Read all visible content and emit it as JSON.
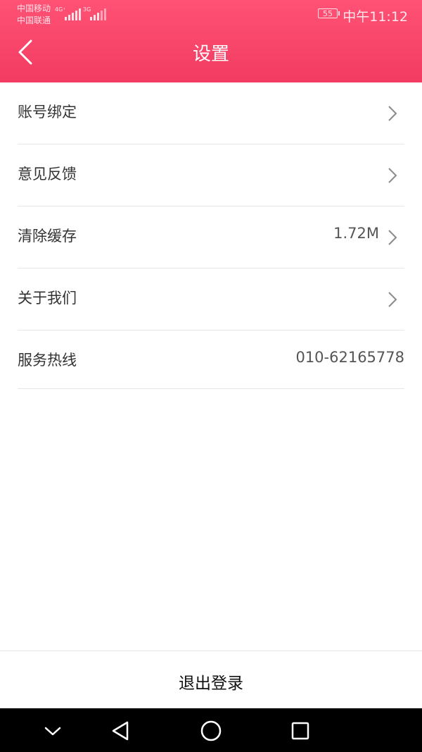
{
  "status_bar": {
    "carrier_1": "中国移动",
    "carrier_2": "中国联通",
    "network_1": "4G⁺",
    "network_2": "3G",
    "battery": "55",
    "time": "中午11:12"
  },
  "nav": {
    "title": "设置",
    "back_icon": "chevron-left-icon"
  },
  "settings": {
    "items": [
      {
        "label": "账号绑定",
        "value": "",
        "icon": "chevron-right-icon"
      },
      {
        "label": "意见反馈",
        "value": "",
        "icon": "chevron-right-icon"
      },
      {
        "label": "清除缓存",
        "value": "1.72M",
        "icon": "chevron-right-icon"
      },
      {
        "label": "关于我们",
        "value": "",
        "icon": "chevron-right-icon"
      },
      {
        "label": "服务热线",
        "value": "010-62165778"
      }
    ]
  },
  "logout": {
    "label": "退出登录"
  },
  "system_nav": {
    "icons": [
      "chevron-down-icon",
      "back-triangle-icon",
      "home-circle-icon",
      "recents-square-icon"
    ]
  },
  "colors": {
    "header": "#f23b61",
    "text": "#333333",
    "divider": "#e6e6e6",
    "system_nav": "#000000"
  }
}
